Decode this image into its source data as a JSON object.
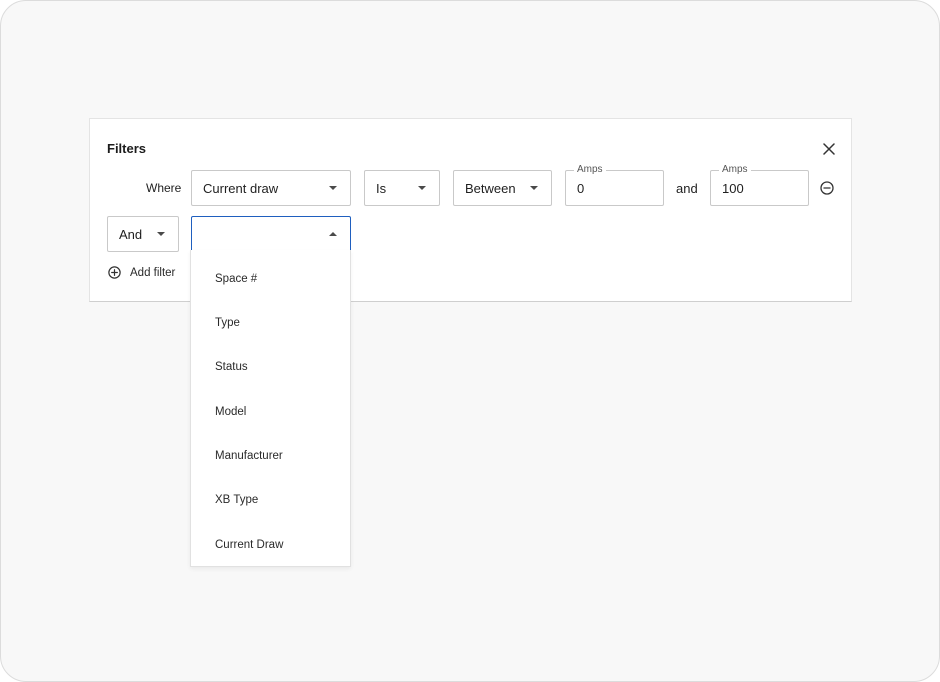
{
  "filters": {
    "title": "Filters",
    "where_label": "Where",
    "row1": {
      "field_value": "Current draw",
      "operator_value": "Is",
      "condition_value": "Between",
      "min": {
        "legend": "Amps",
        "value": "0"
      },
      "and_text": "and",
      "max": {
        "legend": "Amps",
        "value": "100"
      }
    },
    "row2": {
      "conjunction_value": "And",
      "field_value": ""
    },
    "add_filter_label": "Add filter"
  },
  "dropdown": {
    "options": [
      "Space #",
      "Type",
      "Status",
      "Model",
      "Manufacturer",
      "XB Type",
      "Current Draw"
    ]
  },
  "icons": {
    "close": "close-icon",
    "remove": "minus-circle-icon",
    "add": "plus-circle-icon",
    "caret": "chevron-down-icon"
  },
  "colors": {
    "focus_border": "#1f5fbf",
    "background": "#f8f8f8"
  }
}
